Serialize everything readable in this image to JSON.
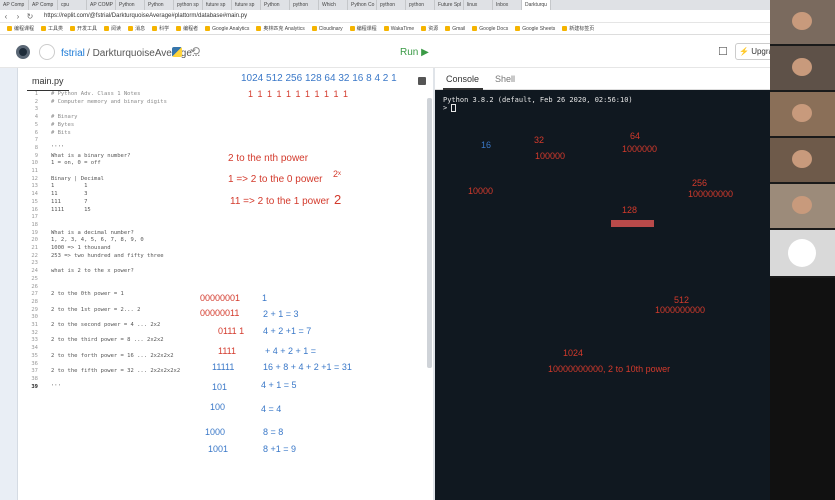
{
  "browser": {
    "tabs": [
      "AP Comp",
      "AP Comp",
      "cpu",
      "AP COMP",
      "Python",
      "Python",
      "python sp",
      "future sp",
      "future sp",
      "Python",
      "python",
      "Which",
      "Python Co",
      "python",
      "python",
      "Future Spl",
      "linux",
      "Inbox",
      "Darkturqu"
    ],
    "active_tab_index": 18,
    "url": "https://replit.com/@fstrial/DarkturquoiseAverage#plattorm/database#main.py",
    "bookmarks": [
      "编程课程",
      "工具类",
      "开发工具",
      "阅读",
      "消息",
      "科学",
      "编程者",
      "Google Analytics",
      "奥林匹克 Analytics",
      "Cloudinary",
      "编程课程",
      "WakaTime",
      "资源",
      "Gmail",
      "Google Docs",
      "Google Sheets",
      "新建标签页"
    ]
  },
  "header": {
    "user": "fstrial",
    "separator": "/",
    "repl_name": "DarkturquoiseAverage...",
    "run_label": "Run ▶",
    "upgrade_label": "Upgrade"
  },
  "editor": {
    "filename": "main.py",
    "lines": [
      {
        "n": "1",
        "t": "# Python Adv. Class 1 Notes",
        "c": true
      },
      {
        "n": "2",
        "t": "# Computer memory and binary digits",
        "c": true
      },
      {
        "n": "3",
        "t": "",
        "c": false
      },
      {
        "n": "4",
        "t": "# Binary",
        "c": true
      },
      {
        "n": "5",
        "t": "# Bytes",
        "c": true
      },
      {
        "n": "6",
        "t": "# Bits",
        "c": true
      },
      {
        "n": "7",
        "t": "",
        "c": false
      },
      {
        "n": "8",
        "t": "''''",
        "c": false
      },
      {
        "n": "9",
        "t": "What is a binary number?",
        "c": false
      },
      {
        "n": "10",
        "t": "1 = on, 0 = off",
        "c": false
      },
      {
        "n": "11",
        "t": "",
        "c": false
      },
      {
        "n": "12",
        "t": "Binary | Decimal",
        "c": false
      },
      {
        "n": "13",
        "t": "1         1",
        "c": false
      },
      {
        "n": "14",
        "t": "11        3",
        "c": false
      },
      {
        "n": "15",
        "t": "111       7",
        "c": false
      },
      {
        "n": "16",
        "t": "1111      15",
        "c": false
      },
      {
        "n": "17",
        "t": "",
        "c": false
      },
      {
        "n": "18",
        "t": "",
        "c": false
      },
      {
        "n": "19",
        "t": "What is a decimal number?",
        "c": false
      },
      {
        "n": "20",
        "t": "1, 2, 3, 4, 5, 6, 7, 8, 9, 0",
        "c": false
      },
      {
        "n": "21",
        "t": "1000 => 1 thousand",
        "c": false
      },
      {
        "n": "22",
        "t": "253 => two hundred and fifty three",
        "c": false
      },
      {
        "n": "23",
        "t": "",
        "c": false
      },
      {
        "n": "24",
        "t": "what is 2 to the x power?",
        "c": false
      },
      {
        "n": "25",
        "t": "",
        "c": false
      },
      {
        "n": "26",
        "t": "",
        "c": false
      },
      {
        "n": "27",
        "t": "2 to the 0th power = 1",
        "c": false
      },
      {
        "n": "28",
        "t": "",
        "c": false
      },
      {
        "n": "29",
        "t": "2 to the 1st power = 2... 2",
        "c": false
      },
      {
        "n": "30",
        "t": "",
        "c": false
      },
      {
        "n": "31",
        "t": "2 to the second power = 4 ... 2x2",
        "c": false
      },
      {
        "n": "32",
        "t": "",
        "c": false
      },
      {
        "n": "33",
        "t": "2 to the third power = 8 ... 2x2x2",
        "c": false
      },
      {
        "n": "34",
        "t": "",
        "c": false
      },
      {
        "n": "35",
        "t": "2 to the forth power = 16 ... 2x2x2x2",
        "c": false
      },
      {
        "n": "36",
        "t": "",
        "c": false
      },
      {
        "n": "37",
        "t": "2 to the fifth power = 32 ... 2x2x2x2x2",
        "c": false
      },
      {
        "n": "38",
        "t": "",
        "c": false
      },
      {
        "n": "39",
        "t": "'''",
        "c": false
      }
    ]
  },
  "console": {
    "tab_console": "Console",
    "tab_shell": "Shell",
    "version_line": "Python 3.8.2 (default, Feb 26 2020, 02:56:10)",
    "prompt": ">"
  },
  "annotations": {
    "powers_header": "1024 512 256 128 64 32 16 8 4 2 1",
    "ones_row": "1    1     1    1   1  1  1   1 1 1 1",
    "two_nth": "2 to the nth power",
    "one_arrow": "1 => 2 to the 0 power",
    "eleven_arrow": "11 => 2 to the 1 power",
    "sup_x": "2ˣ",
    "sup_2": "2",
    "bin1": "00000001",
    "bin2": "00000011",
    "bin3": "0111  1",
    "bin4": "1111",
    "bin5": "11111",
    "bin6": "101",
    "bin7": "100",
    "bin8": "1000",
    "bin9": "1001",
    "sum1": "1",
    "sum2": "2 + 1 = 3",
    "sum3": "4 + 2 +1 = 7",
    "sum4": "+ 4 + 2 + 1 =",
    "sum5": "16 + 8 + 4 + 2 +1 = 31",
    "sum6": "4 + 1 = 5",
    "sum7": "4 = 4",
    "sum8": "8 = 8",
    "sum9": "8 +1 = 9",
    "c16": "16",
    "c32": "32",
    "c100000": "100000",
    "c64": "64",
    "c1000000": "1000000",
    "c10000": "10000",
    "c256": "256",
    "c100000000": "100000000",
    "c128": "128",
    "c512": "512",
    "c1000000000": "1000000000",
    "c1024": "1024",
    "c10th": "10000000000, 2 to 10th power"
  }
}
